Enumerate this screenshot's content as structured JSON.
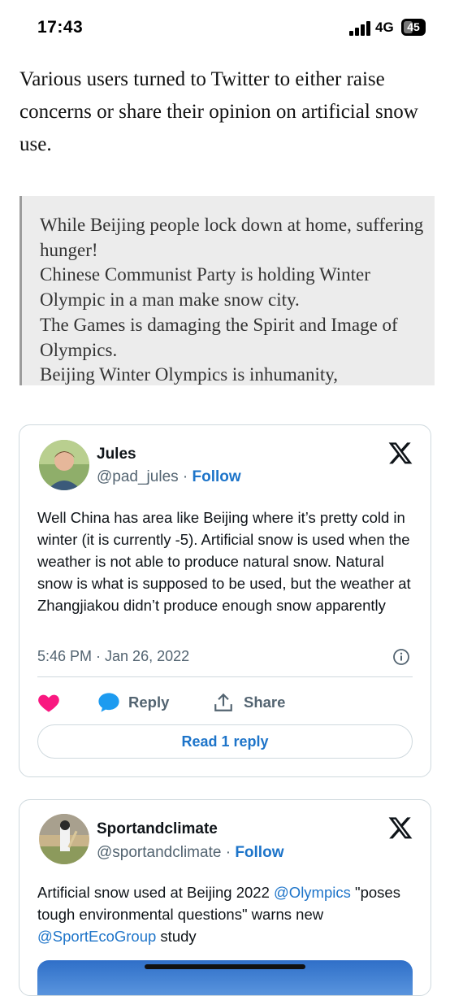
{
  "status_bar": {
    "time": "17:43",
    "network": "4G",
    "battery": "45",
    "battery_level": 0.45
  },
  "article": {
    "intro": "Various users turned to Twitter to either raise concerns or share their opinion on artificial snow use.",
    "quote_lines": [
      "While Beijing people lock down at home, suffering hunger!",
      "Chinese Communist Party is holding Winter Olympic in a man make snow city.",
      "The Games is damaging the Spirit and Image of Olympics.",
      "Beijing Winter Olympics is inhumanity,"
    ]
  },
  "tweets": [
    {
      "name": "Jules",
      "handle": "@pad_jules",
      "separator": "·",
      "follow_label": "Follow",
      "text": "Well China has area like Beijing where  it’s pretty cold in winter (it is currently -5). Artificial snow is used when the weather is not able to produce natural snow. Natural snow is what is supposed to be used, but the weather at Zhangjiakou didn’t produce enough snow apparently",
      "timestamp": "5:46 PM · Jan 26, 2022",
      "reply_label": "Reply",
      "share_label": "Share",
      "read_replies_label": "Read 1 reply",
      "liked": true,
      "like_color": "#f91880"
    },
    {
      "name": "Sportandclimate",
      "handle": "@sportandclimate",
      "separator": "·",
      "follow_label": "Follow",
      "text_parts": [
        {
          "text": "Artificial snow used at Beijing 2022 ",
          "link": false
        },
        {
          "text": "@Olympics",
          "link": true
        },
        {
          "text": " \"poses tough environmental questions\" warns new ",
          "link": false
        },
        {
          "text": "@SportEcoGroup",
          "link": true
        },
        {
          "text": " study",
          "link": false
        }
      ]
    }
  ],
  "colors": {
    "link": "#1d74c9",
    "muted": "#536471",
    "border": "#cfd9de",
    "quote_bg": "#ececec"
  },
  "icons": [
    "x-logo-icon",
    "like-heart-icon",
    "reply-bubble-icon",
    "share-icon",
    "info-icon"
  ]
}
